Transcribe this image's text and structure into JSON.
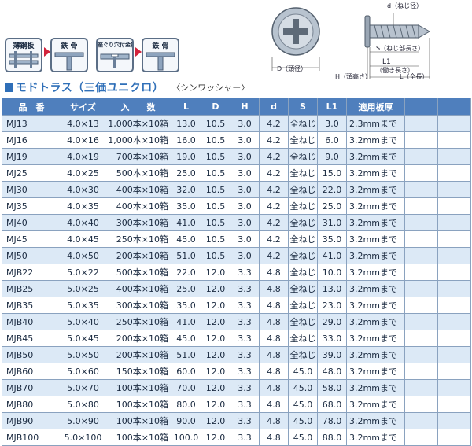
{
  "diagrams": {
    "steps": [
      "薄鋼板",
      "鉄 骨",
      "座ぐり穴付金物",
      "鉄 骨"
    ],
    "screw_labels": {
      "d": "d（ねじ径）",
      "D": "D（頭径）",
      "S": "S（ねじ部長さ）",
      "L1": "L1",
      "L1_note": "（働き長さ）",
      "H": "H（頭高さ）",
      "L": "L（全長）"
    }
  },
  "section": {
    "title": "モドトラス（三価ユニクロ）",
    "subtitle": "〈シンワッシャー〉"
  },
  "table": {
    "headers": [
      "品　番",
      "サイズ",
      "入　　数",
      "L",
      "D",
      "H",
      "d",
      "S",
      "L1",
      "適用板厚",
      "",
      ""
    ],
    "rows": [
      [
        "MJ13",
        "4.0×13",
        "1,000本×10箱",
        "13.0",
        "10.5",
        "3.0",
        "4.2",
        "全ねじ",
        "3.0",
        "2.3mmまで"
      ],
      [
        "MJ16",
        "4.0×16",
        "1,000本×10箱",
        "16.0",
        "10.5",
        "3.0",
        "4.2",
        "全ねじ",
        "6.0",
        "3.2mmまで"
      ],
      [
        "MJ19",
        "4.0×19",
        "700本×10箱",
        "19.0",
        "10.5",
        "3.0",
        "4.2",
        "全ねじ",
        "9.0",
        "3.2mmまで"
      ],
      [
        "MJ25",
        "4.0×25",
        "500本×10箱",
        "25.0",
        "10.5",
        "3.0",
        "4.2",
        "全ねじ",
        "15.0",
        "3.2mmまで"
      ],
      [
        "MJ30",
        "4.0×30",
        "400本×10箱",
        "32.0",
        "10.5",
        "3.0",
        "4.2",
        "全ねじ",
        "22.0",
        "3.2mmまで"
      ],
      [
        "MJ35",
        "4.0×35",
        "400本×10箱",
        "35.0",
        "10.5",
        "3.0",
        "4.2",
        "全ねじ",
        "25.0",
        "3.2mmまで"
      ],
      [
        "MJ40",
        "4.0×40",
        "300本×10箱",
        "41.0",
        "10.5",
        "3.0",
        "4.2",
        "全ねじ",
        "31.0",
        "3.2mmまで"
      ],
      [
        "MJ45",
        "4.0×45",
        "250本×10箱",
        "45.0",
        "10.5",
        "3.0",
        "4.2",
        "全ねじ",
        "35.0",
        "3.2mmまで"
      ],
      [
        "MJ50",
        "4.0×50",
        "200本×10箱",
        "51.0",
        "10.5",
        "3.0",
        "4.2",
        "全ねじ",
        "41.0",
        "3.2mmまで"
      ],
      [
        "MJB22",
        "5.0×22",
        "500本×10箱",
        "22.0",
        "12.0",
        "3.3",
        "4.8",
        "全ねじ",
        "10.0",
        "3.2mmまで"
      ],
      [
        "MJB25",
        "5.0×25",
        "400本×10箱",
        "25.0",
        "12.0",
        "3.3",
        "4.8",
        "全ねじ",
        "13.0",
        "3.2mmまで"
      ],
      [
        "MJB35",
        "5.0×35",
        "300本×10箱",
        "35.0",
        "12.0",
        "3.3",
        "4.8",
        "全ねじ",
        "23.0",
        "3.2mmまで"
      ],
      [
        "MJB40",
        "5.0×40",
        "250本×10箱",
        "41.0",
        "12.0",
        "3.3",
        "4.8",
        "全ねじ",
        "29.0",
        "3.2mmまで"
      ],
      [
        "MJB45",
        "5.0×45",
        "200本×10箱",
        "45.0",
        "12.0",
        "3.3",
        "4.8",
        "全ねじ",
        "33.0",
        "3.2mmまで"
      ],
      [
        "MJB50",
        "5.0×50",
        "200本×10箱",
        "51.0",
        "12.0",
        "3.3",
        "4.8",
        "全ねじ",
        "39.0",
        "3.2mmまで"
      ],
      [
        "MJB60",
        "5.0×60",
        "150本×10箱",
        "60.0",
        "12.0",
        "3.3",
        "4.8",
        "45.0",
        "48.0",
        "3.2mmまで"
      ],
      [
        "MJB70",
        "5.0×70",
        "100本×10箱",
        "70.0",
        "12.0",
        "3.3",
        "4.8",
        "45.0",
        "58.0",
        "3.2mmまで"
      ],
      [
        "MJB80",
        "5.0×80",
        "100本×10箱",
        "80.0",
        "12.0",
        "3.3",
        "4.8",
        "45.0",
        "68.0",
        "3.2mmまで"
      ],
      [
        "MJB90",
        "5.0×90",
        "100本×10箱",
        "90.0",
        "12.0",
        "3.3",
        "4.8",
        "45.0",
        "78.0",
        "3.2mmまで"
      ],
      [
        "MJB100",
        "5.0×100",
        "100本×10箱",
        "100.0",
        "12.0",
        "3.3",
        "4.8",
        "45.0",
        "88.0",
        "3.2mmまで"
      ]
    ]
  },
  "colors": {
    "accent": "#2f6fb8",
    "header_bg": "#4f7fbd",
    "row_stripe": "#dce9f6",
    "arrow": "#d2233c"
  }
}
